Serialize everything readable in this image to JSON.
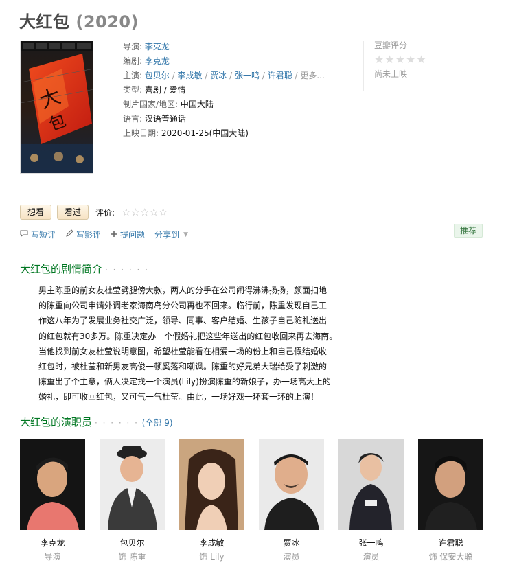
{
  "movie": {
    "title": "大红包",
    "year": "(2020)"
  },
  "info": {
    "director_label": "导演:",
    "director": "李克龙",
    "writer_label": "编剧:",
    "writer": "李克龙",
    "cast_label": "主演:",
    "cast": [
      "包贝尔",
      "李成敏",
      "贾冰",
      "张一鸣",
      "许君聪"
    ],
    "cast_more": "更多...",
    "genre_label": "类型:",
    "genre": "喜剧 / 爱情",
    "country_label": "制片国家/地区:",
    "country": "中国大陆",
    "language_label": "语言:",
    "language": "汉语普通话",
    "release_label": "上映日期:",
    "release": "2020-01-25(中国大陆)"
  },
  "rating": {
    "label": "豆瓣评分",
    "status": "尚未上映"
  },
  "actions": {
    "want": "想看",
    "seen": "看过",
    "rate_label": "评价:"
  },
  "ops": {
    "short_review": "写短评",
    "review": "写影评",
    "question": "提问题",
    "share": "分享到",
    "recommend": "推荐"
  },
  "summary": {
    "title": "大红包的剧情简介",
    "dots": "· · · · · ·",
    "lines": [
      "男主陈重的前女友杜莹劈腿傍大款，两人的分手在公司闹得沸沸扬扬，颜面扫地",
      "的陈重向公司申请外调老家海南岛分公司再也不回来。临行前，陈重发现自己工",
      "作这八年为了发展业务社交广泛，领导、同事、客户结婚、生孩子自己随礼送出",
      "的红包就有30多万。陈重决定办一个假婚礼把这些年送出的红包收回来再去海南。",
      "当他找到前女友杜莹说明意图，希望杜莹能看在相爱一场的份上和自己假结婚收",
      "红包时，被杜莹和新男友高俊一顿奚落和嘲讽。陈重的好兄弟大瑞给受了刺激的",
      "陈重出了个主意，俩人决定找一个演员(Lily)扮演陈重的新娘子，办一场高大上的",
      "婚礼，即可收回红包，又可气一气杜莹。由此，一场好戏一环套一环的上演！"
    ]
  },
  "cast_section": {
    "title": "大红包的演职员",
    "dots": "· · · · · ·",
    "all_open": "(",
    "all_label": "全部 9",
    "all_close": ")",
    "members": [
      {
        "name": "李克龙",
        "role": "导演"
      },
      {
        "name": "包贝尔",
        "role": "饰 陈重"
      },
      {
        "name": "李成敏",
        "role": "饰 Lily"
      },
      {
        "name": "贾冰",
        "role": "演员"
      },
      {
        "name": "张一鸣",
        "role": "演员"
      },
      {
        "name": "许君聪",
        "role": "饰 保安大聪"
      }
    ]
  },
  "colors": {
    "link": "#3377aa",
    "section_green": "#007722",
    "recommend_bg": "#eaf5eb"
  }
}
